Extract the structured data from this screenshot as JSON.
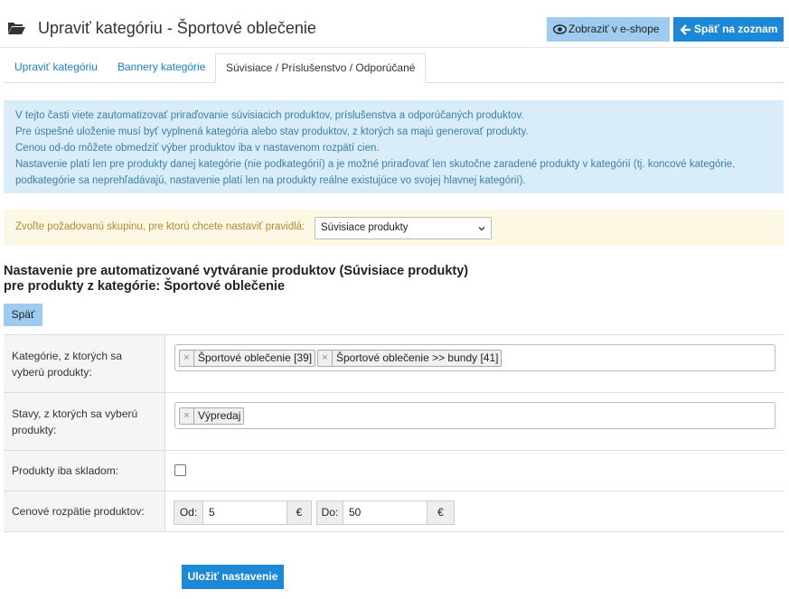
{
  "header": {
    "title": "Upraviť kategóriu - Športové oblečenie",
    "eshop_button": "Zobraziť v e-shope",
    "back_list_button": "Späť na zoznam"
  },
  "tabs": [
    {
      "label": "Upraviť kategóriu",
      "active": false
    },
    {
      "label": "Bannery kategórie",
      "active": false
    },
    {
      "label": "Súvisiace / Príslušenstvo / Odporúčané",
      "active": true
    }
  ],
  "info": {
    "lines": [
      "V tejto časti viete zautomatizovať priraďovanie súvisiacich produktov, príslušenstva a odporúčaných produktov.",
      "Pre úspešné uloženie musí byť vyplnená kategória alebo stav produktov, z ktorých sa majú generovať produkty.",
      "Cenou od-do môžete obmedziť výber produktov iba v nastavenom rozpätí cien.",
      "Nastavenie platí len pre produkty danej kategórie (nie podkategórií) a je možné priraďovať len skutočne zaradené produkty v kategórií (tj. koncové kategórie,",
      "podkategórie sa neprehľadávajú, nastavenie platí len na produkty reálne existujúce vo svojej hlavnej kategórií)."
    ]
  },
  "group": {
    "label": "Zvoľte požadovanú skupinu, pre ktorú chcete nastaviť pravidlá:",
    "selected": "Súvisiace produkty"
  },
  "section": {
    "title_line1": "Nastavenie pre automatizované vytváranie produktov (Súvisiace produkty)",
    "title_line2": "pre produkty z kategórie: Športové oblečenie",
    "back_button": "Späť"
  },
  "form": {
    "categories_label": "Kategórie, z ktorých sa vyberú produkty:",
    "categories_tags": [
      "Športové oblečenie [39]",
      "Športové oblečenie >> bundy [41]"
    ],
    "states_label": "Stavy, z ktorých sa vyberú produkty:",
    "states_tags": [
      "Výpredaj"
    ],
    "stock_label": "Produkty iba skladom:",
    "stock_checked": false,
    "price_label": "Cenové rozpätie produktov:",
    "from_label": "Od:",
    "from_value": "5",
    "to_label": "Do:",
    "to_value": "50",
    "currency": "€",
    "tag_remove": "×",
    "save_button": "Uložiť nastavenie"
  }
}
